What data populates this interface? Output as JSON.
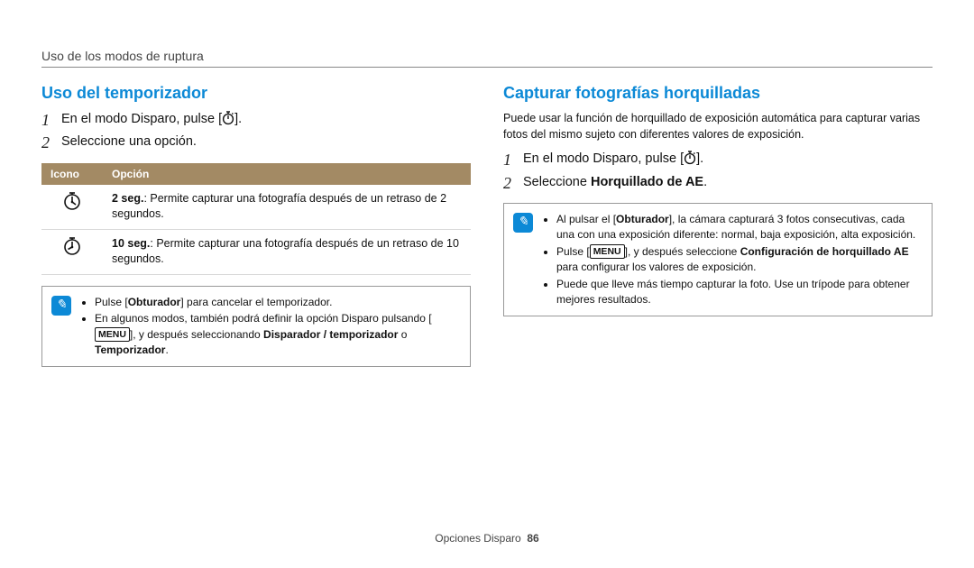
{
  "page_header": "Uso de los modos de ruptura",
  "left": {
    "heading": "Uso del temporizador",
    "steps": [
      {
        "num": "1",
        "pre": "En el modo Disparo, pulse [",
        "post": "]."
      },
      {
        "num": "2",
        "text": "Seleccione una opción."
      }
    ],
    "table": {
      "th_icon": "Icono",
      "th_option": "Opción",
      "rows": [
        {
          "bold": "2 seg.",
          "rest": ": Permite capturar una fotografía después de un retraso de 2 segundos."
        },
        {
          "bold": "10 seg.",
          "rest": ": Permite capturar una fotografía después de un retraso de 10 segundos."
        }
      ]
    },
    "note": {
      "li1_a": "Pulse [",
      "li1_b": "Obturador",
      "li1_c": "] para cancelar el temporizador.",
      "li2_a": "En algunos modos, también podrá definir la opción Disparo pulsando [",
      "li2_b": "], y después seleccionando ",
      "li2_c": "Disparador / temporizador",
      "li2_d": " o ",
      "li2_e": "Temporizador",
      "li2_f": ".",
      "menu_label": "MENU"
    }
  },
  "right": {
    "heading": "Capturar fotografías horquilladas",
    "intro": "Puede usar la función de horquillado de exposición automática para capturar varias fotos del mismo sujeto con diferentes valores de exposición.",
    "steps": [
      {
        "num": "1",
        "pre": "En el modo Disparo, pulse [",
        "post": "]."
      },
      {
        "num": "2",
        "pre": "Seleccione ",
        "bold": "Horquillado de AE",
        "post": "."
      }
    ],
    "note": {
      "li1_a": "Al pulsar el [",
      "li1_b": "Obturador",
      "li1_c": "], la cámara capturará 3 fotos consecutivas, cada una con una exposición diferente: normal, baja exposición, alta exposición.",
      "li2_a": "Pulse [",
      "li2_b": "], y después seleccione ",
      "li2_c": "Configuración de horquillado AE",
      "li2_d": " para configurar los valores de exposición.",
      "li3": "Puede que lleve más tiempo capturar la foto. Use un trípode para obtener mejores resultados.",
      "menu_label": "MENU"
    }
  },
  "footer": {
    "section": "Opciones Disparo",
    "page": "86"
  }
}
